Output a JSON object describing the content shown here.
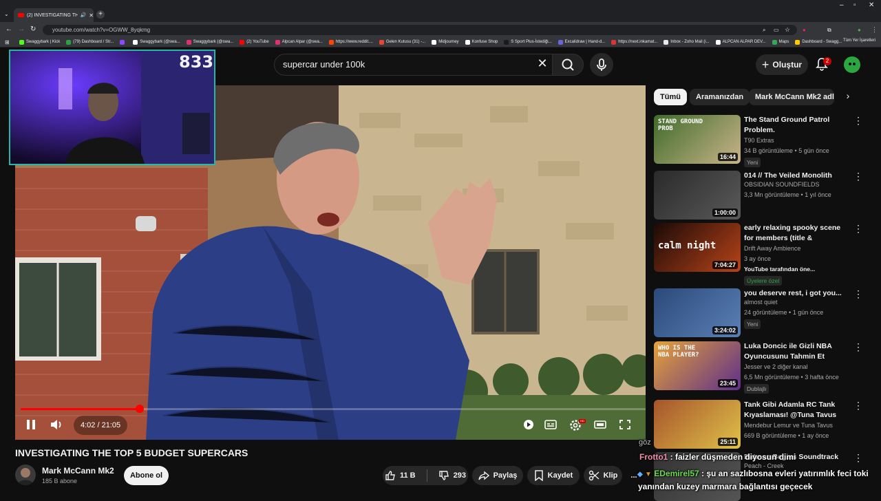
{
  "browser": {
    "tab_title": "(2) INVESTIGATING THE TO",
    "new_tab": "+",
    "url": "youtube.com/watch?v=OGWW_8yqkmg",
    "bookmarks": [
      {
        "label": "Swaggybark | Kick",
        "color": "#53fc18"
      },
      {
        "label": "(79) Dashboard / Str...",
        "color": "#2ea043"
      },
      {
        "label": "",
        "color": "#9146ff"
      },
      {
        "label": "Swaggybark (@swa...",
        "color": "#ffffff"
      },
      {
        "label": "Swaggybark (@swa...",
        "color": "#e1306c"
      },
      {
        "label": "(2) YouTube",
        "color": "#ff0000"
      },
      {
        "label": "Alpcan Alpar (@swa...",
        "color": "#e1306c"
      },
      {
        "label": "https://www.reddit....",
        "color": "#ff4500"
      },
      {
        "label": "Gelen Kutusu (31) -...",
        "color": "#ea4335"
      },
      {
        "label": "Midjourney",
        "color": "#ffffff"
      },
      {
        "label": "Konfuse Shop",
        "color": "#ffffff"
      },
      {
        "label": "S Sport Plus-İstediği...",
        "color": "#1a1a1a"
      },
      {
        "label": "Excalidraw | Hand-d...",
        "color": "#6965db"
      },
      {
        "label": "https://next.inkamat...",
        "color": "#d33"
      },
      {
        "label": "Inbox - Zoho Mail (i...",
        "color": "#e8e8e8"
      },
      {
        "label": "ALPCAN ALPAR DEV...",
        "color": "#ffffff"
      },
      {
        "label": "Maps",
        "color": "#34a853"
      },
      {
        "label": "Dashboard - Swagg...",
        "color": "#ffcc00"
      }
    ],
    "all_bookmarks": "Tüm Yer İşaretleri"
  },
  "header": {
    "search_value": "supercar under 100k",
    "create_label": "Oluştur",
    "notification_count": "2"
  },
  "overlay": {
    "viewer_count": "833"
  },
  "player": {
    "time": "4:02 / 21:05",
    "progress_fraction": 0.191,
    "hd_label": "HD"
  },
  "video": {
    "title": "INVESTIGATING THE TOP 5 BUDGET SUPERCARS",
    "channel": "Mark McCann Mk2",
    "subscribers": "185 B abone",
    "subscribe_label": "Abone ol",
    "likes": "11 B",
    "dislikes": "293",
    "share_label": "Paylaş",
    "save_label": "Kaydet",
    "clip_label": "Klip",
    "more_label": "..."
  },
  "chips": [
    "Tümü",
    "Aramanızdan",
    "Mark McCann Mk2 adlı y"
  ],
  "recommendations": [
    {
      "title": "The Stand Ground Patrol Problem.",
      "channel": "T90 Extras",
      "meta": "34 B görüntüleme • 5 gün önce",
      "badge": "Yeni",
      "duration": "16:44",
      "thumb_text": "STAND GROUND PROB",
      "colors": [
        "#3f6b2a",
        "#c9b48a"
      ]
    },
    {
      "title": "014 // The Veiled Monolith",
      "channel": "OBSIDIAN SOUNDFIELDS",
      "meta": "3,3 Mn görüntüleme • 1 yıl önce",
      "badge": "",
      "duration": "1:00:00",
      "thumb_text": "",
      "colors": [
        "#2a2a2a",
        "#5a5a5a"
      ]
    },
    {
      "title": "early relaxing spooky scene for members (title & thumbnail ...",
      "channel": "Drift Away Ambience",
      "meta": "3 ay önce",
      "badge": "YouTube tarafından öne...",
      "member": "Üyelere özel",
      "duration": "7:04:27",
      "thumb_text": "calm night",
      "colors": [
        "#1b0a06",
        "#b8431a"
      ]
    },
    {
      "title": "you deserve rest, i got you...",
      "channel": "almost quiet",
      "meta": "24 görüntüleme • 1 gün önce",
      "badge": "Yeni",
      "duration": "3:24:02",
      "thumb_text": "",
      "colors": [
        "#2b4a7a",
        "#5b7fb5"
      ]
    },
    {
      "title": "Luka Doncic ile Gizli NBA Oyuncusunu Tahmin Et",
      "channel": "Jesser ve 2 diğer kanal",
      "meta": "6,5 Mn görüntüleme • 3 hafta önce",
      "badge": "Dublajlı",
      "duration": "23:45",
      "thumb_text": "WHO IS THE NBA PLAYER?",
      "colors": [
        "#e7a23a",
        "#5d2f8a"
      ]
    },
    {
      "title": "Tank Gibi Adamla RC Tank Kıyaslaması! @Tuna Tavus",
      "channel": "Mendebur Lemur ve Tuna Tavus",
      "meta": "669 B görüntüleme • 1 ay önce",
      "badge": "",
      "duration": "25:11",
      "thumb_text": "",
      "colors": [
        "#a6542a",
        "#e0c24a"
      ]
    },
    {
      "title": "Batman Begins Soundtrack",
      "channel": "Peach - Creek",
      "meta": "",
      "badge": "",
      "duration": "",
      "thumb_text": "",
      "colors": [
        "#333",
        "#555"
      ]
    }
  ],
  "chat": [
    {
      "user": "Frotto1",
      "text": " : faizler düşmeden diyosun dimi",
      "color": "#f28db2"
    },
    {
      "user": "EDemirel57",
      "text": " : şu an sazlıbosna evleri yatırımlık feci toki",
      "color": "#6bdc4a"
    },
    {
      "user": "",
      "text": "yanından kuzey marmara bağlantısı geçecek",
      "color": "#ffffff"
    }
  ],
  "chat_fragment": "göz"
}
